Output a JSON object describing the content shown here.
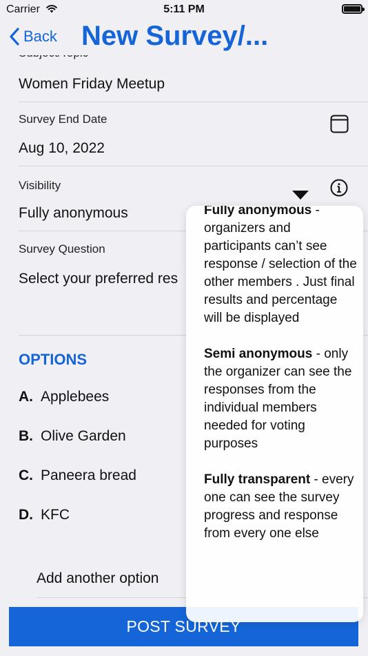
{
  "status_bar": {
    "carrier": "Carrier",
    "time": "5:11 PM"
  },
  "nav": {
    "back_label": "Back",
    "title": "New Survey/..."
  },
  "form": {
    "subject_label": "Subject/Topic",
    "subject_value": "Women Friday Meetup",
    "end_date_label": "Survey End Date",
    "end_date_value": "Aug 10, 2022",
    "visibility_label": "Visibility",
    "visibility_value": "Fully anonymous",
    "question_label": "Survey Question",
    "question_value": "Select your preferred res"
  },
  "options": {
    "heading": "OPTIONS",
    "items": [
      {
        "letter": "A.",
        "text": "Applebees"
      },
      {
        "letter": "B.",
        "text": "Olive Garden"
      },
      {
        "letter": "C.",
        "text": "Paneera bread"
      },
      {
        "letter": "D.",
        "text": "KFC"
      }
    ],
    "add_label": "Add another option"
  },
  "post_button": "POST SURVEY",
  "popover": {
    "blocks": [
      {
        "title": "Fully anonymous",
        "body": " - organizers and participants can’t see response / selection of the other members . Just final results and percentage will be displayed"
      },
      {
        "title": "Semi anonymous",
        "body": " - only the organizer can see the responses from the individual members needed for voting purposes"
      },
      {
        "title": "Fully transparent",
        "body": " - every one can see the survey progress and response from every one else"
      }
    ]
  },
  "colors": {
    "accent": "#1565d8",
    "background": "#efeff4"
  },
  "icons": [
    "wifi-icon",
    "battery-icon",
    "back-chevron-icon",
    "calendar-icon",
    "info-icon"
  ]
}
